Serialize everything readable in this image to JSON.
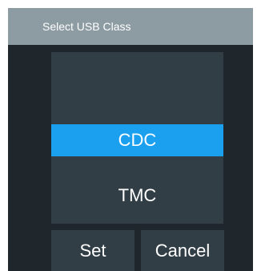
{
  "dialog": {
    "title": "Select USB Class",
    "options": [
      {
        "label": "CDC",
        "selected": true
      },
      {
        "label": "TMC",
        "selected": false
      }
    ],
    "buttons": {
      "set_label": "Set",
      "cancel_label": "Cancel"
    },
    "colors": {
      "titlebar": "#8d9ba3",
      "background": "#1f272d",
      "panel": "#323e46",
      "selection": "#1aa0ef",
      "text": "#ffffff"
    }
  }
}
